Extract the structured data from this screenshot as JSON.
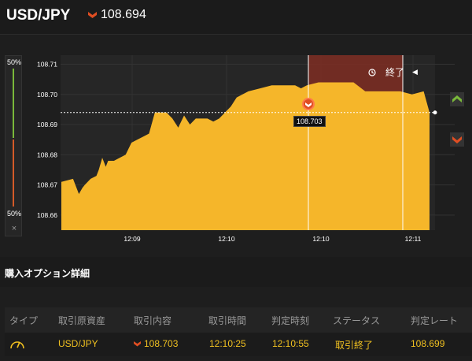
{
  "header": {
    "pair": "USD/JPY",
    "direction_icon": "chevron-down-icon",
    "price": "108.694"
  },
  "gauge": {
    "top_pct": "50%",
    "bottom_pct": "50%",
    "close_glyph": "×"
  },
  "expiry": {
    "label": "終了",
    "clock_icon": "clock-icon"
  },
  "tooltip": {
    "price": "108.703"
  },
  "side_buttons": {
    "up_icon": "chevron-up-icon",
    "down_icon": "chevron-down-icon"
  },
  "colors": {
    "area": "#f5b62a",
    "up": "#7ab83a",
    "down": "#d45a28",
    "expiry_band": "#7a2e24"
  },
  "chart_data": {
    "type": "area",
    "y_ticks": [
      "108.71",
      "108.70",
      "108.69",
      "108.68",
      "108.67",
      "108.66"
    ],
    "y_tick_values": [
      108.71,
      108.7,
      108.69,
      108.68,
      108.67,
      108.66
    ],
    "x_ticks": [
      "12:09",
      "12:10",
      "12:10",
      "12:11"
    ],
    "x_tick_minutes": [
      0,
      1,
      2,
      3
    ],
    "ylim": [
      108.655,
      108.713
    ],
    "current_price": 108.694,
    "entry_price": 108.703,
    "series": [
      {
        "x": [
          0,
          0.1,
          0.12,
          0.15,
          0.18,
          0.2,
          0.25,
          0.3,
          0.32,
          0.35,
          0.38,
          0.4,
          0.45,
          0.5,
          0.55,
          0.6,
          0.65,
          0.7,
          0.75,
          0.8,
          0.85,
          0.9,
          0.95,
          1.0,
          1.05,
          1.1,
          1.15,
          1.2,
          1.25,
          1.3,
          1.35,
          1.4,
          1.45,
          1.5,
          1.55,
          1.6,
          1.7,
          1.8,
          1.9,
          2.0,
          2.05,
          2.1,
          2.2,
          2.3,
          2.4,
          2.5,
          2.6,
          2.7,
          2.8,
          2.9,
          3.0,
          3.1,
          3.15
        ],
        "values": [
          108.671,
          108.672,
          108.67,
          108.667,
          108.669,
          108.67,
          108.672,
          108.673,
          108.675,
          108.679,
          108.676,
          108.678,
          108.678,
          108.679,
          108.68,
          108.684,
          108.685,
          108.686,
          108.687,
          108.694,
          108.694,
          108.694,
          108.692,
          108.689,
          108.693,
          108.69,
          108.692,
          108.692,
          108.692,
          108.691,
          108.692,
          108.694,
          108.696,
          108.699,
          108.7,
          108.701,
          108.702,
          108.703,
          108.703,
          108.703,
          108.702,
          108.703,
          108.704,
          108.704,
          108.704,
          108.704,
          108.701,
          108.701,
          108.701,
          108.701,
          108.7,
          108.701,
          108.694
        ]
      }
    ]
  },
  "purchase_section": {
    "title": "購入オプション詳細"
  },
  "table": {
    "headers": [
      "タイプ",
      "取引原資産",
      "取引内容",
      "取引時間",
      "判定時刻",
      "ステータス",
      "判定レート"
    ],
    "row": {
      "type_icon": "gauge-icon",
      "asset": "USD/JPY",
      "direction_icon": "chevron-down-icon",
      "content": "108.703",
      "trade_time": "12:10:25",
      "judge_time": "12:10:55",
      "status": "取引終了",
      "rate": "108.699"
    }
  }
}
